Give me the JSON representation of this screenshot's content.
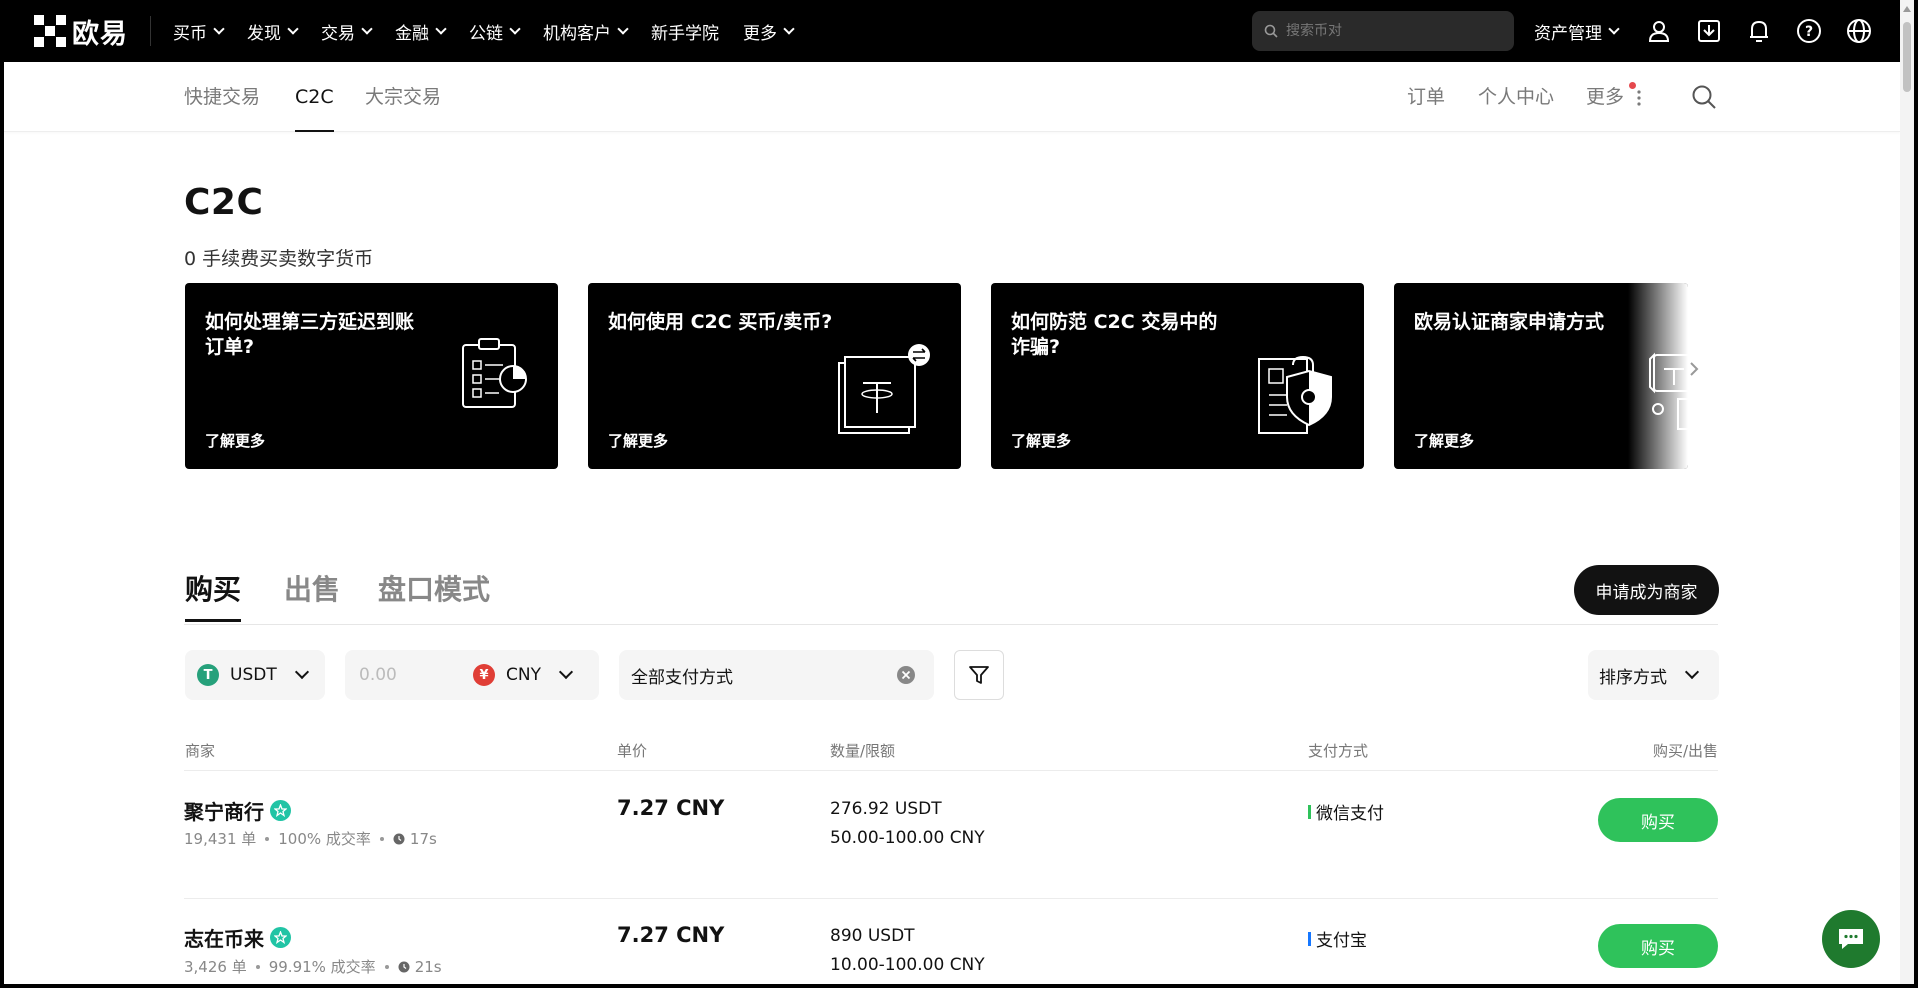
{
  "brand": {
    "name": "欧易"
  },
  "topnav": {
    "items": [
      {
        "label": "买币",
        "chevron": true
      },
      {
        "label": "发现",
        "chevron": true
      },
      {
        "label": "交易",
        "chevron": true
      },
      {
        "label": "金融",
        "chevron": true
      },
      {
        "label": "公链",
        "chevron": true
      },
      {
        "label": "机构客户",
        "chevron": true
      },
      {
        "label": "新手学院",
        "chevron": false
      },
      {
        "label": "更多",
        "chevron": true
      }
    ],
    "search_placeholder": "搜索币对",
    "asset_label": "资产管理",
    "icons": [
      "user-icon",
      "download-icon",
      "bell-icon",
      "help-icon",
      "globe-icon"
    ]
  },
  "subnav": {
    "tabs": [
      "快捷交易",
      "C2C",
      "大宗交易"
    ],
    "active_tab": "C2C",
    "right": {
      "orders": "订单",
      "profile": "个人中心",
      "more": "更多"
    }
  },
  "hero": {
    "title": "C2C",
    "subtitle": "0 手续费买卖数字货币"
  },
  "cards": [
    {
      "title": "如何处理第三方延迟到账订单?",
      "more": "了解更多",
      "icon": "clipboard-chart-icon"
    },
    {
      "title": "如何使用 C2C 买币/卖币?",
      "more": "了解更多",
      "icon": "usdt-exchange-icon"
    },
    {
      "title": "如何防范 C2C 交易中的诈骗?",
      "more": "了解更多",
      "icon": "shield-lock-icon"
    },
    {
      "title": "欧易认证商家申请方式",
      "more": "了解更多",
      "icon": "merchant-icon"
    }
  ],
  "tabs": {
    "items": [
      "购买",
      "出售",
      "盘口模式"
    ],
    "active": "购买",
    "merchant_button": "申请成为商家"
  },
  "filters": {
    "coin": {
      "symbol": "USDT",
      "icon_char": "T",
      "color": "#26a17b"
    },
    "amount_placeholder": "0.00",
    "fiat": {
      "symbol": "CNY",
      "icon_char": "¥",
      "color": "#e03e36"
    },
    "payment": "全部支付方式",
    "sort": "排序方式"
  },
  "table": {
    "headers": [
      "商家",
      "单价",
      "数量/限额",
      "支付方式",
      "购买/出售"
    ],
    "rows": [
      {
        "merchant": "聚宁商行",
        "orders": "19,431 单",
        "completion": "100% 成交率",
        "time": "17s",
        "price": "7.27 CNY",
        "quantity": "276.92 USDT",
        "limit": "50.00-100.00 CNY",
        "payment": "微信支付",
        "payment_color": "#2fc25b",
        "action": "购买"
      },
      {
        "merchant": "志在币来",
        "orders": "3,426 单",
        "completion": "99.91% 成交率",
        "time": "21s",
        "price": "7.27 CNY",
        "quantity": "890 USDT",
        "limit": "10.00-100.00 CNY",
        "payment": "支付宝",
        "payment_color": "#1677ff",
        "action": "购买"
      }
    ]
  },
  "colors": {
    "accent_buy": "#2fc25b",
    "brand_black": "#000000",
    "verified": "#21c4a5"
  }
}
